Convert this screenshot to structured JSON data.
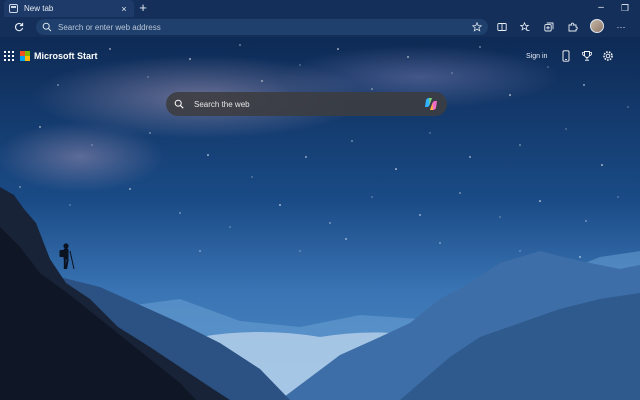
{
  "window": {
    "tab": {
      "title": "New tab",
      "close_glyph": "×"
    },
    "new_tab_glyph": "+",
    "controls": {
      "minimize": "–",
      "restore": "❐"
    }
  },
  "toolbar": {
    "address_placeholder": "Search or enter web address",
    "more_glyph": "···"
  },
  "newtab": {
    "brand": "Microsoft Start",
    "signin_label": "Sign in",
    "search_placeholder": "Search the web"
  },
  "colors": {
    "titlebar": "#14305a",
    "tab_active": "#1d3a68",
    "address_bg": "#1f3f6c",
    "search_box": "#3c3c40",
    "ms_red": "#f25022",
    "ms_green": "#7fba00",
    "ms_blue": "#00a4ef",
    "ms_yellow": "#ffb900"
  },
  "icons": {
    "tab": "newtab-page-icon",
    "refresh": "refresh-icon",
    "info": "site-info-icon",
    "favorite": "star-outline-icon",
    "split": "split-screen-icon",
    "favorites": "favorites-icon",
    "collections": "collections-icon",
    "extensions": "extensions-icon",
    "phone": "phone-icon",
    "rewards": "rewards-trophy-icon",
    "settings": "gear-icon",
    "search": "search-icon",
    "copilot": "copilot-icon"
  }
}
